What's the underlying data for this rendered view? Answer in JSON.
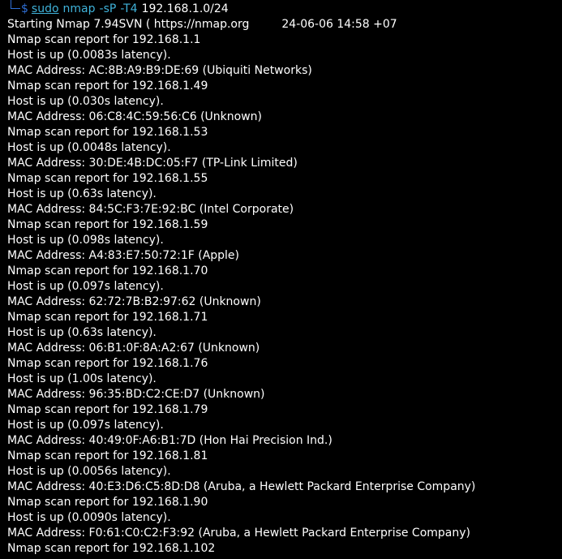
{
  "prompt": {
    "symbol": "$",
    "sudo": "sudo",
    "command": "nmap",
    "flag1": "-sP",
    "flag2": "-T4",
    "target": "192.168.1.0/24"
  },
  "start_line": {
    "left": "Starting Nmap 7.94SVN ( https://nmap.org",
    "right": "24-06-06 14:58 +07"
  },
  "lines": [
    "Nmap scan report for 192.168.1.1",
    "Host is up (0.0083s latency).",
    "MAC Address: AC:8B:A9:B9:DE:69 (Ubiquiti Networks)",
    "Nmap scan report for 192.168.1.49",
    "Host is up (0.030s latency).",
    "MAC Address: 06:C8:4C:59:56:C6 (Unknown)",
    "Nmap scan report for 192.168.1.53",
    "Host is up (0.0048s latency).",
    "MAC Address: 30:DE:4B:DC:05:F7 (TP-Link Limited)",
    "Nmap scan report for 192.168.1.55",
    "Host is up (0.63s latency).",
    "MAC Address: 84:5C:F3:7E:92:BC (Intel Corporate)",
    "Nmap scan report for 192.168.1.59",
    "Host is up (0.098s latency).",
    "MAC Address: A4:83:E7:50:72:1F (Apple)",
    "Nmap scan report for 192.168.1.70",
    "Host is up (0.097s latency).",
    "MAC Address: 62:72:7B:B2:97:62 (Unknown)",
    "Nmap scan report for 192.168.1.71",
    "Host is up (0.63s latency).",
    "MAC Address: 06:B1:0F:8A:A2:67 (Unknown)",
    "Nmap scan report for 192.168.1.76",
    "Host is up (1.00s latency).",
    "MAC Address: 96:35:BD:C2:CE:D7 (Unknown)",
    "Nmap scan report for 192.168.1.79",
    "Host is up (0.097s latency).",
    "MAC Address: 40:49:0F:A6:B1:7D (Hon Hai Precision Ind.)",
    "Nmap scan report for 192.168.1.81",
    "Host is up (0.0056s latency).",
    "MAC Address: 40:E3:D6:C5:8D:D8 (Aruba, a Hewlett Packard Enterprise Company)",
    "Nmap scan report for 192.168.1.90",
    "Host is up (0.0090s latency).",
    "MAC Address: F0:61:C0:C2:F3:92 (Aruba, a Hewlett Packard Enterprise Company)",
    "Nmap scan report for 192.168.1.102"
  ],
  "colors": {
    "background": "#000000",
    "text": "#ffffff",
    "prompt": "#2f6fd6",
    "command": "#3fb2d9"
  }
}
